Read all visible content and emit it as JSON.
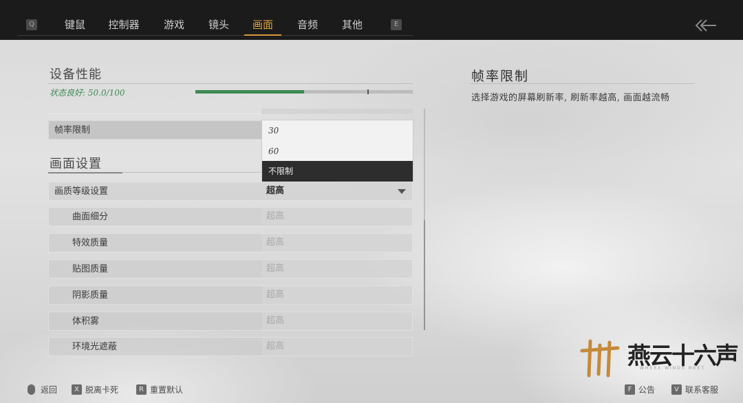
{
  "topbar": {
    "left_key": "Q",
    "right_key": "E",
    "tabs": [
      {
        "label": "键鼠",
        "active": false
      },
      {
        "label": "控制器",
        "active": false
      },
      {
        "label": "游戏",
        "active": false
      },
      {
        "label": "镜头",
        "active": false
      },
      {
        "label": "画面",
        "active": true
      },
      {
        "label": "音频",
        "active": false
      },
      {
        "label": "其他",
        "active": false
      }
    ],
    "back_icon": "double-chevron-left-arrow-icon",
    "active_color": "#e0a542"
  },
  "device": {
    "title": "设备性能",
    "status": "状态良好: 50.0/100",
    "score": 50.0,
    "max_score": 100,
    "bar_color": "#3f8a54"
  },
  "frame_limit": {
    "label": "帧率限制",
    "options": [
      "30",
      "60",
      "不限制"
    ],
    "selected": "不限制"
  },
  "display_settings": {
    "title": "画面设置",
    "quality_label": "画质等级设置",
    "quality_value": "超高",
    "sub_items": [
      {
        "label": "曲面细分",
        "value": "超高"
      },
      {
        "label": "特效质量",
        "value": "超高"
      },
      {
        "label": "贴图质量",
        "value": "超高"
      },
      {
        "label": "阴影质量",
        "value": "超高"
      },
      {
        "label": "体积雾",
        "value": "超高"
      },
      {
        "label": "环境光遮蔽",
        "value": "超高"
      }
    ]
  },
  "info": {
    "title": "帧率限制",
    "description": "选择游戏的屏幕刷新率, 刷新率越高, 画面越流畅"
  },
  "bottom": {
    "back": {
      "icon": "mouse-icon",
      "label": "返回"
    },
    "unstuck": {
      "key": "X",
      "label": "脱离卡死"
    },
    "reset": {
      "key": "R",
      "label": "重置默认"
    },
    "notice": {
      "key": "F",
      "label": "公告"
    },
    "support": {
      "key": "V",
      "label": "联系客服"
    }
  },
  "logo": {
    "text": "燕云十六声",
    "subtext": "WHERE WINDS MEET"
  }
}
